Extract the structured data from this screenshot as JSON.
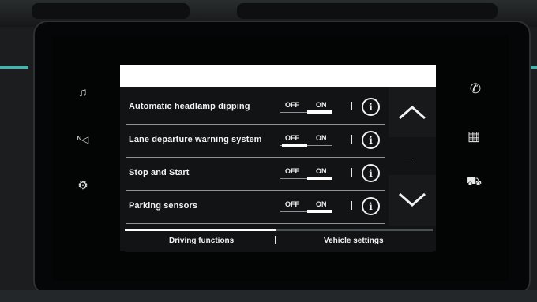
{
  "sidebar_left": {
    "icons": [
      "music-note-icon",
      "navigation-icon",
      "vehicle-settings-icon"
    ],
    "glyphs": [
      "♫",
      "ᴺ◁",
      "⚙"
    ]
  },
  "sidebar_right": {
    "icons": [
      "phone-icon",
      "apps-grid-icon",
      "car-icon"
    ],
    "glyphs": [
      "✆",
      "▦",
      "⛟"
    ]
  },
  "settings": [
    {
      "label": "Automatic headlamp dipping",
      "off_label": "OFF",
      "on_label": "ON",
      "state": "on"
    },
    {
      "label": "Lane departure warning system",
      "off_label": "OFF",
      "on_label": "ON",
      "state": "off"
    },
    {
      "label": "Stop and Start",
      "off_label": "OFF",
      "on_label": "ON",
      "state": "on"
    },
    {
      "label": "Parking sensors",
      "off_label": "OFF",
      "on_label": "ON",
      "state": "on"
    }
  ],
  "info_glyph": "i",
  "scroll": {
    "up_icon": "chevron-up-icon",
    "down_icon": "chevron-down-icon"
  },
  "tabs": [
    {
      "label": "Driving functions",
      "active": true
    },
    {
      "label": "Vehicle settings",
      "active": false
    }
  ],
  "colors": {
    "accent": "#3fb6b0",
    "header": "#ffffff",
    "panel": "#111314"
  }
}
